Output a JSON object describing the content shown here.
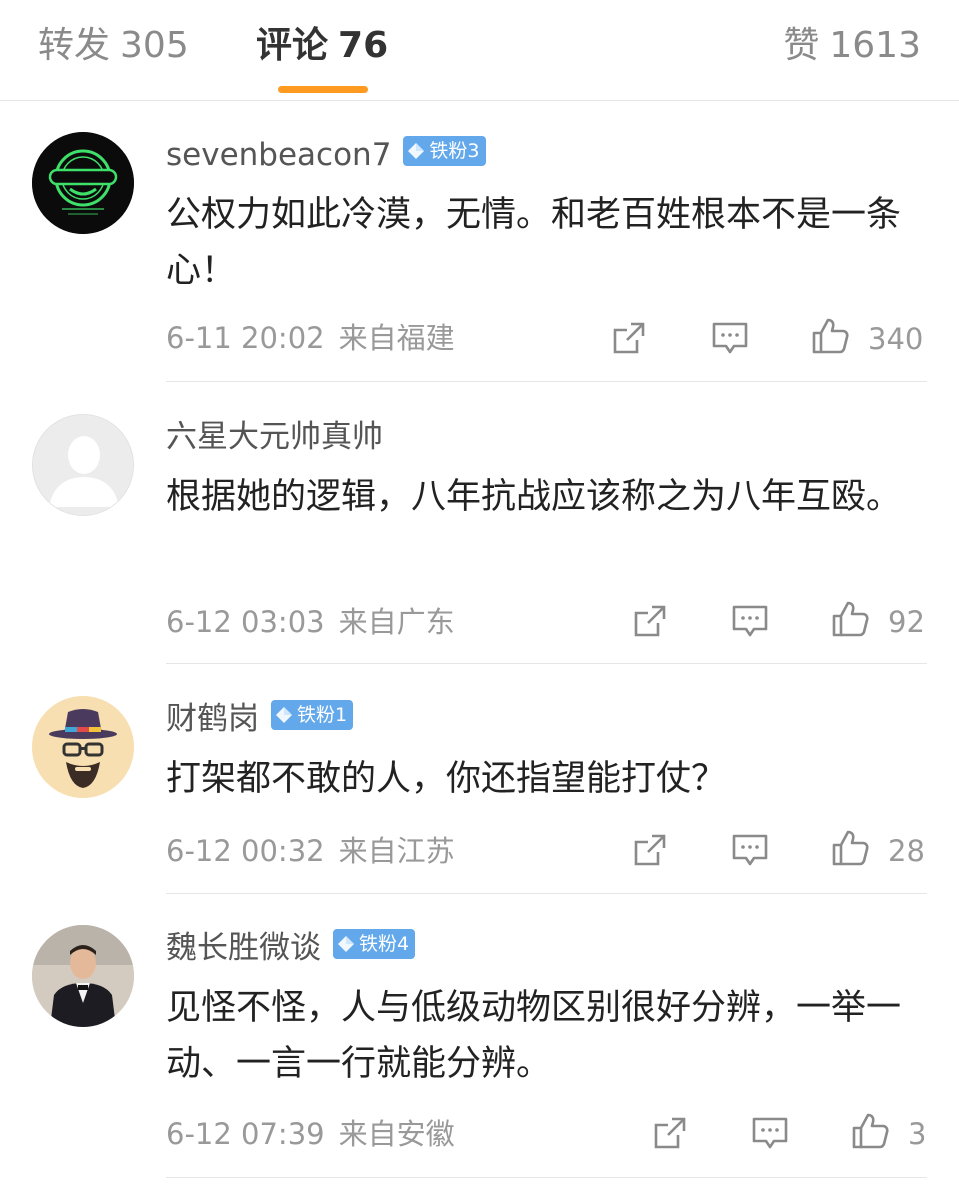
{
  "tabs": {
    "repost": {
      "label": "转发",
      "count": "305"
    },
    "comment": {
      "label": "评论",
      "count": "76"
    },
    "like": {
      "label": "赞",
      "count": "1613"
    },
    "active_color": "#ff9a21"
  },
  "comments": [
    {
      "username": "sevenbeacon7",
      "badge": "铁粉3",
      "text": "公权力如此冷漠，无情。和老百姓根本不是一条心！",
      "time": "6-11 20:02",
      "source": "来自福建",
      "likes": "340",
      "avatar_icon": "laughing-man-logo"
    },
    {
      "username": "六星大元帅真帅",
      "badge": "",
      "text": "根据她的逻辑，八年抗战应该称之为八年互殴。",
      "time": "6-12 03:03",
      "source": "来自广东",
      "likes": "92",
      "avatar_icon": "default-user-silhouette"
    },
    {
      "username": "财鹤岗",
      "badge": "铁粉1",
      "text": "打架都不敢的人，你还指望能打仗？",
      "time": "6-12 00:32",
      "source": "来自江苏",
      "likes": "28",
      "avatar_icon": "hat-and-glasses-avatar"
    },
    {
      "username": "魏长胜微谈",
      "badge": "铁粉4",
      "text": "见怪不怪，人与低级动物区别很好分辨，一举一动、一言一行就能分辨。",
      "time": "6-12 07:39",
      "source": "来自安徽",
      "likes": "3",
      "avatar_icon": "man-in-suit-photo"
    }
  ],
  "colors": {
    "badge": "#63a8ea",
    "text": "#222222",
    "meta": "#999999"
  }
}
